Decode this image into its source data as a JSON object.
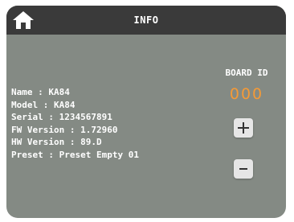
{
  "header": {
    "title": "INFO",
    "home_icon": "home-icon"
  },
  "info": {
    "name": "Name : KA84",
    "model": "Model : KA84",
    "serial": "Serial : 1234567891",
    "fw_version": "FW Version : 1.72960",
    "hw_version": "HW Version : 89.D",
    "preset": "Preset : Preset Empty 01"
  },
  "board": {
    "label": "BOARD ID",
    "value": "000",
    "increment_icon": "plus-icon",
    "decrement_icon": "minus-icon"
  },
  "colors": {
    "panel": "#848a84",
    "header": "#3a3a3a",
    "accent": "#f59a36",
    "text": "#ffffff",
    "button": "#e6e6e6"
  }
}
